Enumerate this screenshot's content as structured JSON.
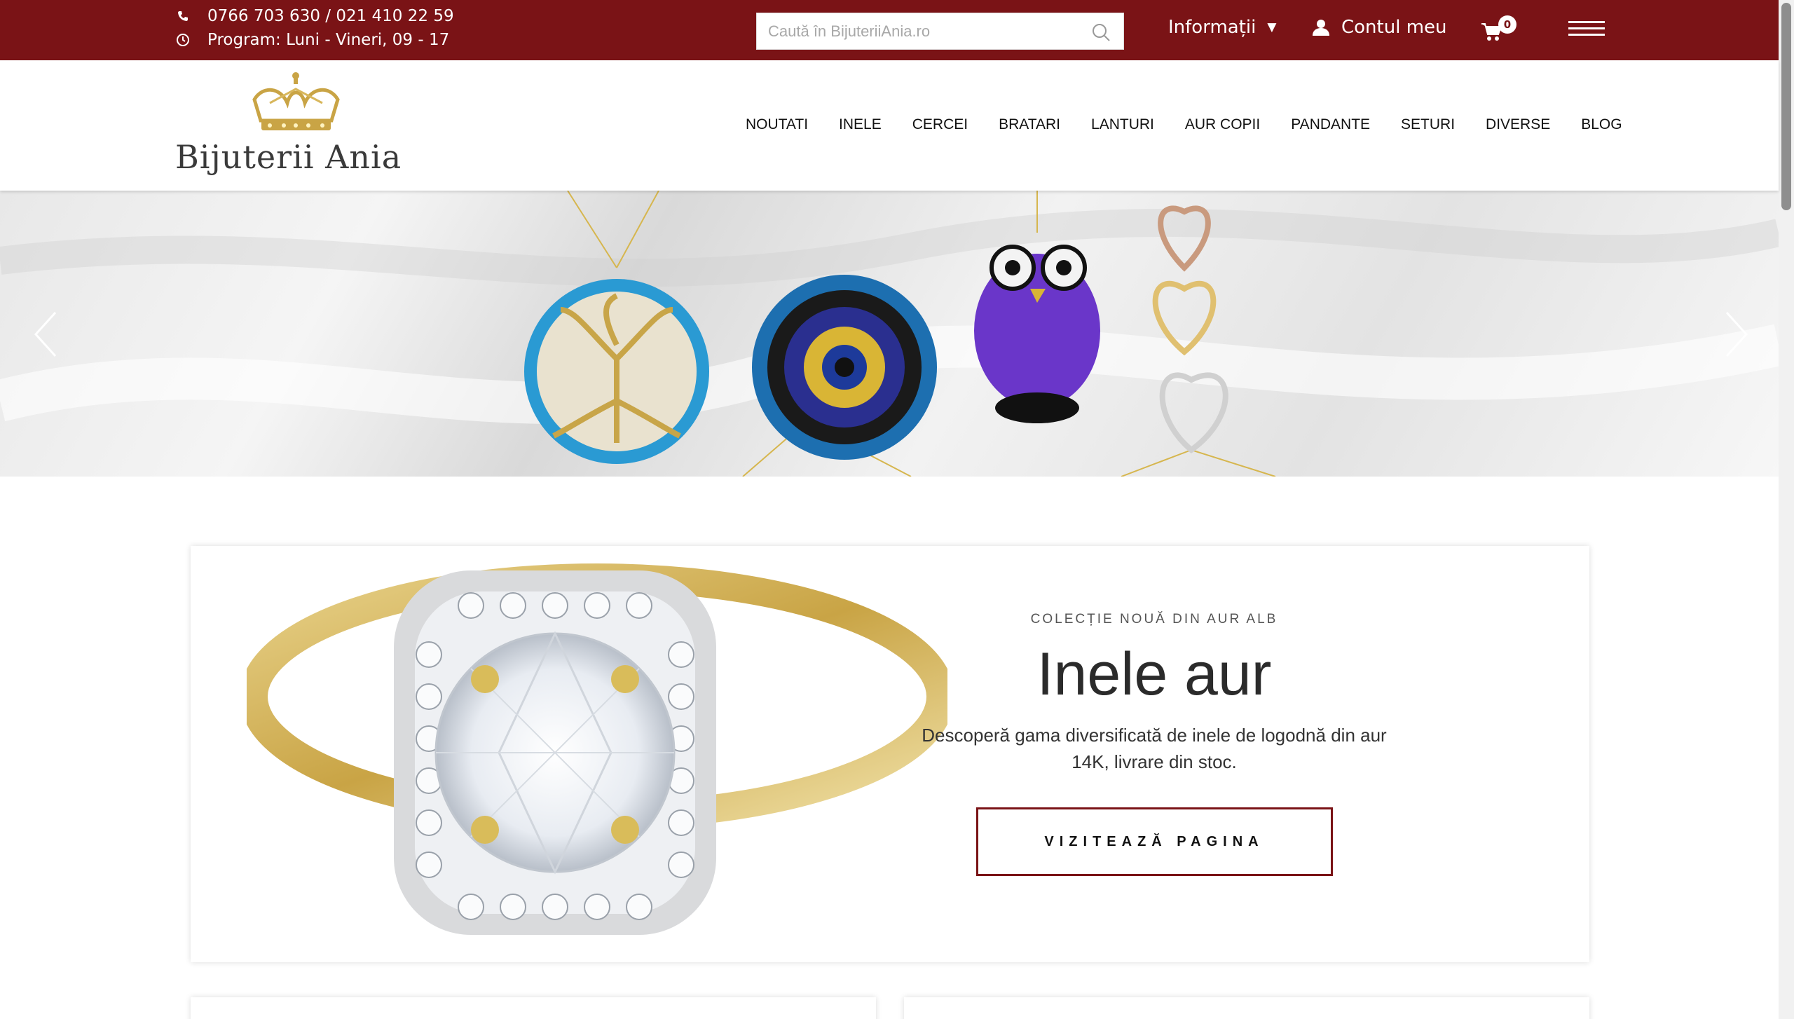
{
  "topbar": {
    "phone": "0766 703 630 / 021 410 22 59",
    "hours": "Program: Luni - Vineri, 09 - 17",
    "search_placeholder": "Caută în BijuteriiAnia.ro",
    "info_label": "Informații",
    "account_label": "Contul meu",
    "cart_count": "0",
    "colors": {
      "bar": "#7a1316",
      "text": "#ffffff"
    }
  },
  "header": {
    "logo_text": "Bijuterii Ania",
    "nav": [
      "NOUTATI",
      "INELE",
      "CERCEI",
      "BRATARI",
      "LANTURI",
      "AUR COPII",
      "PANDANTE",
      "SETURI",
      "DIVERSE",
      "BLOG"
    ]
  },
  "slider": {
    "icons": [
      "chevron-left-icon",
      "chevron-right-icon"
    ]
  },
  "promo": {
    "eyebrow": "COLECȚIE NOUĂ DIN AUR ALB",
    "title": "Inele aur",
    "description": "Descoperă gama diversificată de inele de logodnă din aur 14K, livrare din stoc.",
    "button": "VIZITEAZĂ PAGINA",
    "accent": "#7a1316"
  }
}
